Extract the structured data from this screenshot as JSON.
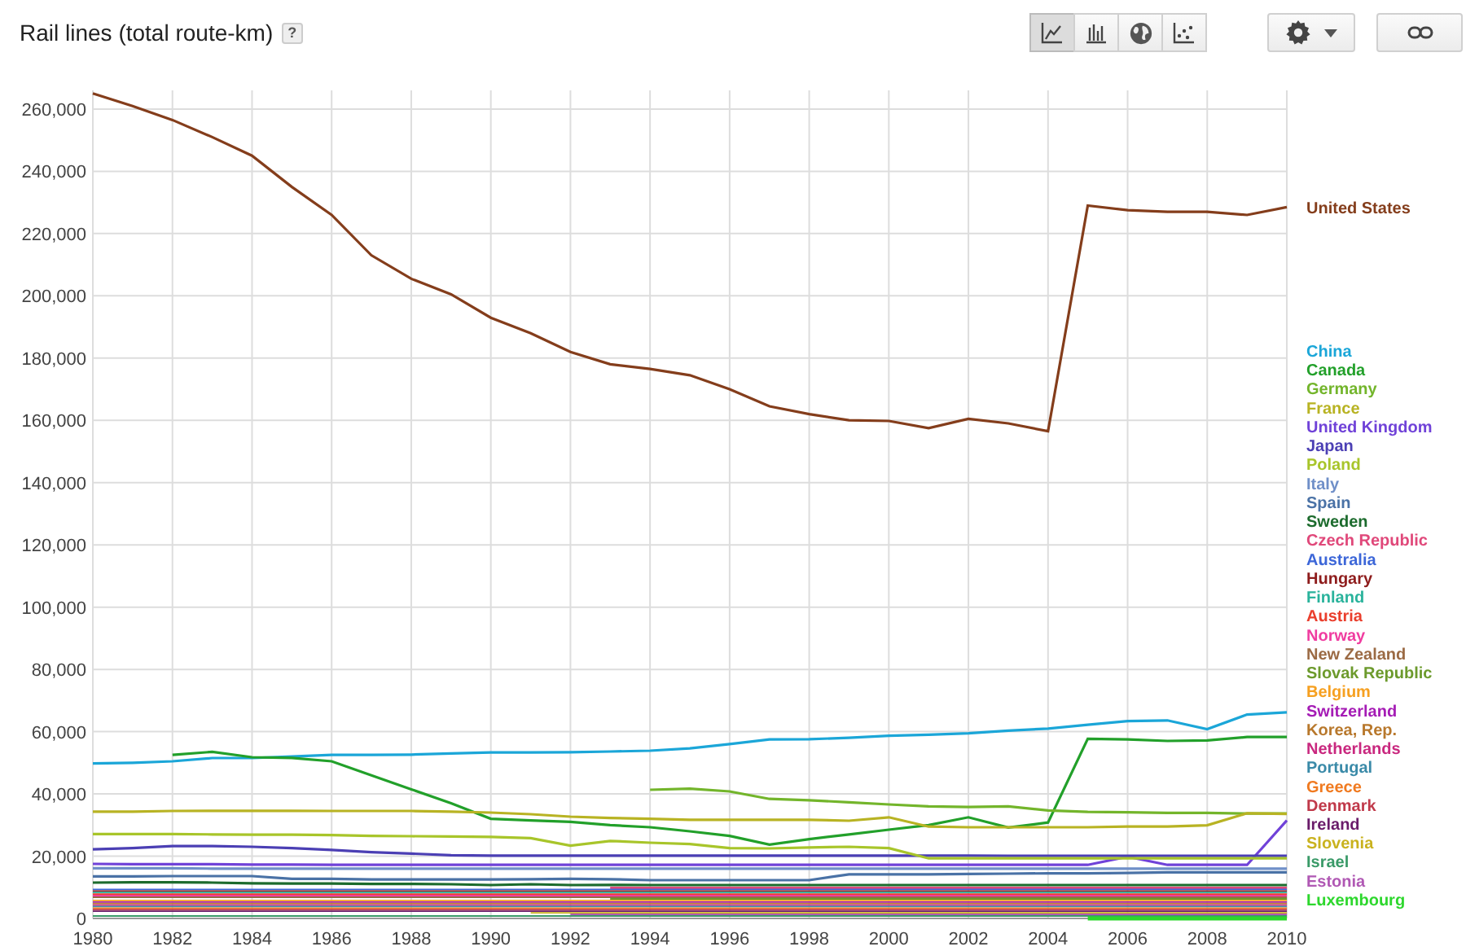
{
  "header": {
    "title": "Rail lines (total route-km)",
    "help": "?"
  },
  "view_buttons": [
    {
      "kind": "line",
      "selected": true
    },
    {
      "kind": "bar",
      "selected": false
    },
    {
      "kind": "map",
      "selected": false
    },
    {
      "kind": "scatter",
      "selected": false
    }
  ],
  "chart": {
    "chart_data": {
      "type": "line",
      "grid": true,
      "x": [
        1980,
        1981,
        1982,
        1983,
        1984,
        1985,
        1986,
        1987,
        1988,
        1989,
        1990,
        1991,
        1992,
        1993,
        1994,
        1995,
        1996,
        1997,
        1998,
        1999,
        2000,
        2001,
        2002,
        2003,
        2004,
        2005,
        2006,
        2007,
        2008,
        2009,
        2010
      ],
      "xlim": [
        1980,
        2010
      ],
      "xticks": [
        1980,
        1982,
        1984,
        1986,
        1988,
        1990,
        1992,
        1994,
        1996,
        1998,
        2000,
        2002,
        2004,
        2006,
        2008,
        2010
      ],
      "yticks": [
        {
          "value": 0,
          "label": "0"
        },
        {
          "value": 20000,
          "label": "20,000"
        },
        {
          "value": 40000,
          "label": "40,000"
        },
        {
          "value": 60000,
          "label": "60,000"
        },
        {
          "value": 80000,
          "label": "80,000"
        },
        {
          "value": 100000,
          "label": "100,000"
        },
        {
          "value": 120000,
          "label": "120,000"
        },
        {
          "value": 140000,
          "label": "140,000"
        },
        {
          "value": 160000,
          "label": "160,000"
        },
        {
          "value": 180000,
          "label": "180,000"
        },
        {
          "value": 200000,
          "label": "200,000"
        },
        {
          "value": 220000,
          "label": "220,000"
        },
        {
          "value": 240000,
          "label": "240,000"
        },
        {
          "value": 260000,
          "label": "260,000"
        }
      ],
      "ylim": [
        0,
        266000
      ],
      "series": [
        {
          "name": "United States",
          "color": "#843d1b",
          "values": [
            265000,
            261000,
            256500,
            251000,
            245000,
            235000,
            226000,
            213000,
            205500,
            200500,
            193000,
            188000,
            182000,
            178000,
            176500,
            174500,
            170000,
            164500,
            162000,
            160000,
            159800,
            157500,
            160500,
            159000,
            156500,
            229000,
            227500,
            227000,
            227000,
            226000,
            228500
          ]
        },
        {
          "name": "China",
          "color": "#1ba6d8",
          "values": [
            49800,
            50000,
            50500,
            51500,
            51500,
            52000,
            52500,
            52500,
            52600,
            53000,
            53300,
            53300,
            53400,
            53600,
            53900,
            54600,
            56000,
            57500,
            57600,
            58000,
            58700,
            59000,
            59500,
            60300,
            61000,
            62200,
            63400,
            63600,
            60800,
            65500,
            66200
          ]
        },
        {
          "name": "Canada",
          "color": "#22a02a",
          "values": [
            null,
            null,
            52500,
            53500,
            51800,
            51600,
            50500,
            46000,
            41500,
            37000,
            32000,
            31500,
            31000,
            30000,
            29300,
            28000,
            26500,
            23700,
            25500,
            27000,
            28500,
            30000,
            32500,
            29200,
            30800,
            57700,
            57500,
            57000,
            57200,
            58300,
            58300
          ]
        },
        {
          "name": "Germany",
          "color": "#73b52b",
          "values": [
            null,
            null,
            null,
            null,
            null,
            null,
            null,
            null,
            null,
            null,
            null,
            null,
            null,
            null,
            41300,
            41700,
            40800,
            38400,
            38000,
            37300,
            36600,
            36000,
            35800,
            36000,
            34700,
            34200,
            34100,
            33900,
            33900,
            33700,
            33700
          ]
        },
        {
          "name": "France",
          "color": "#b8b323",
          "values": [
            34300,
            34300,
            34500,
            34600,
            34600,
            34600,
            34500,
            34500,
            34500,
            34300,
            34000,
            33500,
            32700,
            32300,
            32000,
            31700,
            31700,
            31700,
            31700,
            31400,
            32500,
            29500,
            29300,
            29300,
            29300,
            29300,
            29500,
            29500,
            29900,
            33800,
            33600
          ]
        },
        {
          "name": "United Kingdom",
          "color": "#7042d8",
          "values": [
            17500,
            17400,
            17400,
            17400,
            17300,
            17300,
            17200,
            17200,
            17200,
            17200,
            17200,
            17200,
            17200,
            17200,
            17200,
            17200,
            17200,
            17200,
            17200,
            17200,
            17200,
            17200,
            17200,
            17200,
            17200,
            17200,
            19800,
            17200,
            17200,
            17200,
            31500
          ]
        },
        {
          "name": "Japan",
          "color": "#4b3fb4",
          "values": [
            22200,
            22600,
            23200,
            23200,
            23000,
            22600,
            22000,
            21300,
            20800,
            20300,
            20200,
            20200,
            20200,
            20200,
            20200,
            20200,
            20200,
            20200,
            20200,
            20200,
            20200,
            20200,
            20200,
            20100,
            20100,
            20100,
            20100,
            20100,
            20100,
            20100,
            20100
          ]
        },
        {
          "name": "Poland",
          "color": "#a8c52a",
          "values": [
            27100,
            27100,
            27100,
            27000,
            26900,
            26900,
            26800,
            26500,
            26400,
            26300,
            26200,
            25800,
            23400,
            24900,
            24300,
            23900,
            22600,
            22500,
            22800,
            23000,
            22600,
            19300,
            19300,
            19300,
            19300,
            19300,
            19300,
            19300,
            19300,
            19300,
            19300
          ]
        },
        {
          "name": "Italy",
          "color": "#6f8fc8",
          "values": [
            16100,
            16100,
            16100,
            16000,
            16000,
            16000,
            16000,
            16000,
            16000,
            16000,
            16000,
            16000,
            16000,
            16000,
            16000,
            16000,
            16000,
            16000,
            16000,
            16000,
            16000,
            16000,
            16000,
            16000,
            16000,
            16000,
            16000,
            16000,
            16000,
            16000,
            16000
          ]
        },
        {
          "name": "Spain",
          "color": "#4a72a6",
          "values": [
            13500,
            13500,
            13600,
            13600,
            13600,
            12700,
            12700,
            12500,
            12500,
            12500,
            12500,
            12600,
            12700,
            12600,
            12300,
            12300,
            12300,
            12300,
            12300,
            14200,
            14200,
            14200,
            14300,
            14400,
            14500,
            14500,
            14600,
            14800,
            14800,
            14800,
            14800
          ]
        },
        {
          "name": "Sweden",
          "color": "#1c6b2d",
          "values": [
            11500,
            11600,
            11600,
            11500,
            11300,
            11200,
            11200,
            11100,
            11100,
            11000,
            10700,
            11000,
            10700,
            10800,
            10700,
            10700,
            10700,
            10700,
            10700,
            10700,
            10700,
            10700,
            10700,
            10700,
            10700,
            10700,
            10700,
            10700,
            10700,
            10700,
            10700
          ]
        },
        {
          "name": "Czech Republic",
          "color": "#e0487a",
          "values": [
            null,
            null,
            null,
            null,
            null,
            null,
            null,
            null,
            null,
            null,
            null,
            null,
            null,
            9800,
            9800,
            9800,
            9800,
            9800,
            9800,
            9800,
            9800,
            9800,
            9800,
            9800,
            9800,
            9800,
            9800,
            9800,
            9800,
            9800,
            9800
          ]
        },
        {
          "name": "Australia",
          "color": "#3c66d8",
          "values": [
            9300,
            9300,
            9300,
            9300,
            9300,
            9300,
            9300,
            9300,
            9300,
            9300,
            9300,
            9300,
            9300,
            9300,
            9300,
            9300,
            9300,
            9300,
            9300,
            9300,
            9300,
            9300,
            9300,
            9300,
            9300,
            9300,
            9300,
            9300,
            9300,
            9300,
            9300
          ]
        },
        {
          "name": "Hungary",
          "color": "#8e1c1c",
          "values": [
            8800,
            8800,
            8800,
            8800,
            8800,
            8800,
            8800,
            8800,
            8800,
            8800,
            8800,
            8800,
            8800,
            8800,
            8800,
            8800,
            8800,
            8800,
            8800,
            8800,
            8800,
            8800,
            8800,
            8800,
            8800,
            8800,
            8800,
            8800,
            8800,
            8800,
            8800
          ]
        },
        {
          "name": "Finland",
          "color": "#2ab39c",
          "values": [
            8300,
            8300,
            8300,
            8300,
            8300,
            8300,
            8300,
            8300,
            8300,
            8300,
            8300,
            8300,
            8300,
            8300,
            8300,
            8300,
            8300,
            8300,
            8300,
            8300,
            8300,
            8300,
            8300,
            8300,
            8300,
            8300,
            8300,
            8300,
            8300,
            8300,
            8300
          ]
        },
        {
          "name": "Austria",
          "color": "#ea3e2c",
          "values": [
            7800,
            7800,
            7800,
            7800,
            7800,
            7800,
            7800,
            7800,
            7800,
            7800,
            7800,
            7800,
            7800,
            7800,
            7800,
            7800,
            7800,
            7800,
            7800,
            7800,
            7800,
            7800,
            7800,
            7800,
            7800,
            7800,
            7800,
            7800,
            7800,
            7800,
            7800
          ]
        },
        {
          "name": "Norway",
          "color": "#f03ca0",
          "values": [
            7300,
            7300,
            7300,
            7300,
            7300,
            7300,
            7300,
            7300,
            7300,
            7300,
            7300,
            7300,
            7300,
            7300,
            7300,
            7300,
            7300,
            7300,
            7300,
            7300,
            7300,
            7300,
            7300,
            7300,
            7300,
            7300,
            7300,
            7300,
            7300,
            7300,
            7300
          ]
        },
        {
          "name": "New Zealand",
          "color": "#9b6a44",
          "values": [
            6800,
            6800,
            6800,
            6800,
            6800,
            6800,
            6800,
            6800,
            6800,
            6800,
            6800,
            6800,
            6800,
            6800,
            6800,
            6800,
            6800,
            6800,
            6800,
            6800,
            6800,
            6800,
            6800,
            6800,
            6800,
            6800,
            6800,
            6800,
            6800,
            6800,
            6800
          ]
        },
        {
          "name": "Slovak Republic",
          "color": "#6c9a2c",
          "values": [
            null,
            null,
            null,
            null,
            null,
            null,
            null,
            null,
            null,
            null,
            null,
            null,
            null,
            6300,
            6300,
            6300,
            6300,
            6300,
            6300,
            6300,
            6300,
            6300,
            6300,
            6300,
            6300,
            6300,
            6300,
            6300,
            6300,
            6300,
            6300
          ]
        },
        {
          "name": "Belgium",
          "color": "#f6a021",
          "values": [
            5800,
            5800,
            5800,
            5800,
            5800,
            5800,
            5800,
            5800,
            5800,
            5800,
            5800,
            5800,
            5800,
            5800,
            5800,
            5800,
            5800,
            5800,
            5800,
            5800,
            5800,
            5800,
            5800,
            5800,
            5800,
            5800,
            5800,
            5800,
            5800,
            5800,
            5800
          ]
        },
        {
          "name": "Switzerland",
          "color": "#a51cb5",
          "values": [
            5300,
            5300,
            5300,
            5300,
            5300,
            5300,
            5300,
            5300,
            5300,
            5300,
            5300,
            5300,
            5300,
            5300,
            5300,
            5300,
            5300,
            5300,
            5300,
            5300,
            5300,
            5300,
            5300,
            5300,
            5300,
            5300,
            5300,
            5300,
            5300,
            5300,
            5300
          ]
        },
        {
          "name": "Korea, Rep.",
          "color": "#b8782c",
          "values": [
            4800,
            4800,
            4800,
            4800,
            4800,
            4800,
            4800,
            4800,
            4800,
            4800,
            4800,
            4800,
            4800,
            4800,
            4800,
            4800,
            4800,
            4800,
            4800,
            4800,
            4800,
            4800,
            4800,
            4800,
            4800,
            4800,
            4800,
            4800,
            4800,
            4800,
            4800
          ]
        },
        {
          "name": "Netherlands",
          "color": "#c9287f",
          "values": [
            4300,
            4300,
            4300,
            4300,
            4300,
            4300,
            4300,
            4300,
            4300,
            4300,
            4300,
            4300,
            4300,
            4300,
            4300,
            4300,
            4300,
            4300,
            4300,
            4300,
            4300,
            4300,
            4300,
            4300,
            4300,
            4300,
            4300,
            4300,
            4300,
            4300,
            4300
          ]
        },
        {
          "name": "Portugal",
          "color": "#3a8aa8",
          "values": [
            3800,
            3800,
            3800,
            3800,
            3800,
            3800,
            3800,
            3800,
            3800,
            3800,
            3800,
            3800,
            3800,
            3800,
            3800,
            3800,
            3800,
            3800,
            3800,
            3800,
            3800,
            3800,
            3800,
            3800,
            3800,
            3800,
            3800,
            3800,
            3800,
            3800,
            3800
          ]
        },
        {
          "name": "Greece",
          "color": "#f07a20",
          "values": [
            3300,
            3300,
            3300,
            3300,
            3300,
            3300,
            3300,
            3300,
            3300,
            3300,
            3300,
            3300,
            3300,
            3300,
            3300,
            3300,
            3300,
            3300,
            3300,
            3300,
            3300,
            3300,
            3300,
            3300,
            3300,
            3300,
            3300,
            3300,
            3300,
            3300,
            3300
          ]
        },
        {
          "name": "Denmark",
          "color": "#c0394a",
          "values": [
            2800,
            2800,
            2800,
            2800,
            2800,
            2800,
            2800,
            2800,
            2800,
            2800,
            2800,
            2800,
            2800,
            2800,
            2800,
            2800,
            2800,
            2800,
            2800,
            2800,
            2800,
            2800,
            2800,
            2800,
            2800,
            2800,
            2800,
            2800,
            2800,
            2800,
            2800
          ]
        },
        {
          "name": "Ireland",
          "color": "#6a1c6a",
          "values": [
            2300,
            2300,
            2300,
            2300,
            2300,
            2300,
            2300,
            2300,
            2300,
            2300,
            2300,
            2300,
            2300,
            2300,
            2300,
            2300,
            2300,
            2300,
            2300,
            2300,
            2300,
            2300,
            2300,
            2300,
            2300,
            2300,
            2300,
            2300,
            2300,
            2300,
            2300
          ]
        },
        {
          "name": "Slovenia",
          "color": "#c9b21e",
          "values": [
            null,
            null,
            null,
            null,
            null,
            null,
            null,
            null,
            null,
            null,
            null,
            1800,
            1800,
            1800,
            1800,
            1800,
            1800,
            1800,
            1800,
            1800,
            1800,
            1800,
            1800,
            1800,
            1800,
            1800,
            1800,
            1800,
            1800,
            1800,
            1800
          ]
        },
        {
          "name": "Israel",
          "color": "#3a9a68",
          "values": [
            800,
            800,
            800,
            800,
            800,
            800,
            800,
            800,
            800,
            800,
            800,
            800,
            800,
            800,
            800,
            800,
            800,
            800,
            800,
            800,
            800,
            800,
            800,
            800,
            800,
            800,
            800,
            800,
            800,
            800,
            800
          ]
        },
        {
          "name": "Estonia",
          "color": "#b058b4",
          "values": [
            null,
            null,
            null,
            null,
            null,
            null,
            null,
            null,
            null,
            null,
            null,
            null,
            1300,
            1300,
            1300,
            1300,
            1300,
            1300,
            1300,
            1300,
            1300,
            1300,
            1300,
            1300,
            1300,
            1300,
            1300,
            1300,
            1300,
            1300,
            1300
          ]
        },
        {
          "name": "Luxembourg",
          "color": "#2dd72d",
          "values": [
            null,
            null,
            null,
            null,
            null,
            null,
            null,
            null,
            null,
            null,
            null,
            null,
            null,
            null,
            null,
            null,
            null,
            null,
            null,
            null,
            null,
            null,
            null,
            null,
            null,
            0,
            0,
            0,
            0,
            0,
            0
          ]
        }
      ]
    }
  }
}
